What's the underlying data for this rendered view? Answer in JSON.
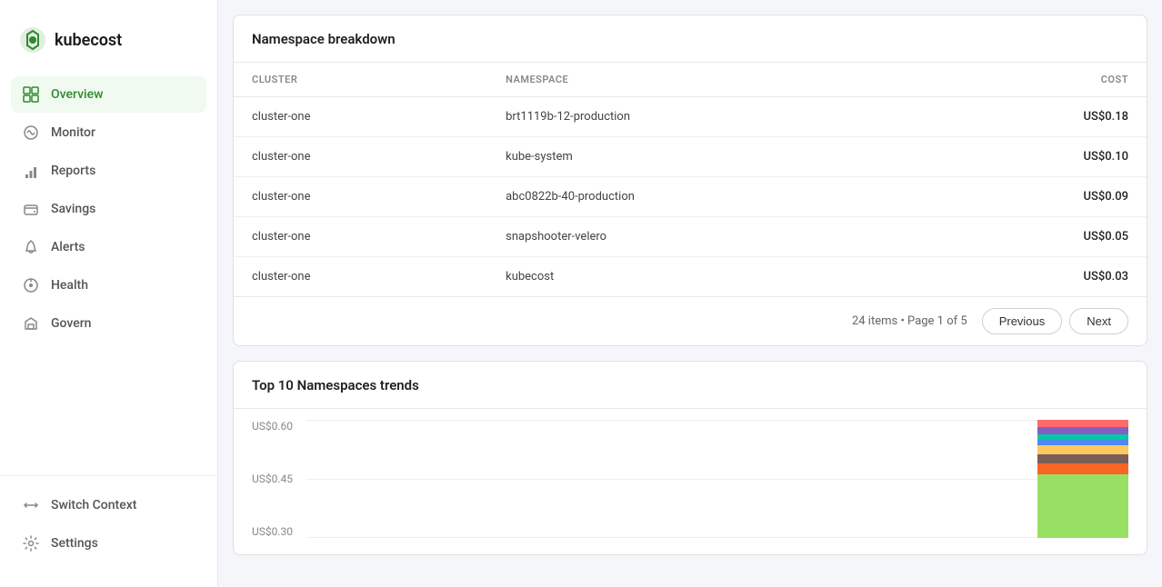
{
  "sidebar": {
    "logo": {
      "text": "kubecost"
    },
    "nav_items": [
      {
        "id": "overview",
        "label": "Overview",
        "active": true
      },
      {
        "id": "monitor",
        "label": "Monitor",
        "active": false
      },
      {
        "id": "reports",
        "label": "Reports",
        "active": false
      },
      {
        "id": "savings",
        "label": "Savings",
        "active": false
      },
      {
        "id": "alerts",
        "label": "Alerts",
        "active": false
      },
      {
        "id": "health",
        "label": "Health",
        "active": false
      },
      {
        "id": "govern",
        "label": "Govern",
        "active": false
      }
    ],
    "bottom_items": [
      {
        "id": "switch-context",
        "label": "Switch Context"
      },
      {
        "id": "settings",
        "label": "Settings"
      }
    ]
  },
  "namespace_breakdown": {
    "title": "Namespace breakdown",
    "columns": {
      "cluster": "CLUSTER",
      "namespace": "NAMESPACE",
      "cost": "COST"
    },
    "rows": [
      {
        "cluster": "cluster-one",
        "namespace": "brt1119b-12-production",
        "cost": "US$0.18"
      },
      {
        "cluster": "cluster-one",
        "namespace": "kube-system",
        "cost": "US$0.10"
      },
      {
        "cluster": "cluster-one",
        "namespace": "abc0822b-40-production",
        "cost": "US$0.09"
      },
      {
        "cluster": "cluster-one",
        "namespace": "snapshooter-velero",
        "cost": "US$0.05"
      },
      {
        "cluster": "cluster-one",
        "namespace": "kubecost",
        "cost": "US$0.03"
      }
    ],
    "pagination": {
      "info": "24 items • Page 1 of 5",
      "previous": "Previous",
      "next": "Next"
    }
  },
  "trends": {
    "title": "Top 10 Namespaces trends",
    "y_labels": [
      "US$0.60",
      "US$0.45",
      "US$0.30"
    ],
    "bar_segments": [
      {
        "color": "#ff6b6b",
        "height": 8
      },
      {
        "color": "#845ec2",
        "height": 8
      },
      {
        "color": "#00c9a7",
        "height": 6
      },
      {
        "color": "#4d8af0",
        "height": 6
      },
      {
        "color": "#ffc75f",
        "height": 10
      },
      {
        "color": "#7b5e57",
        "height": 10
      },
      {
        "color": "#f86624",
        "height": 12
      },
      {
        "color": "#98e063",
        "height": 70
      }
    ]
  }
}
